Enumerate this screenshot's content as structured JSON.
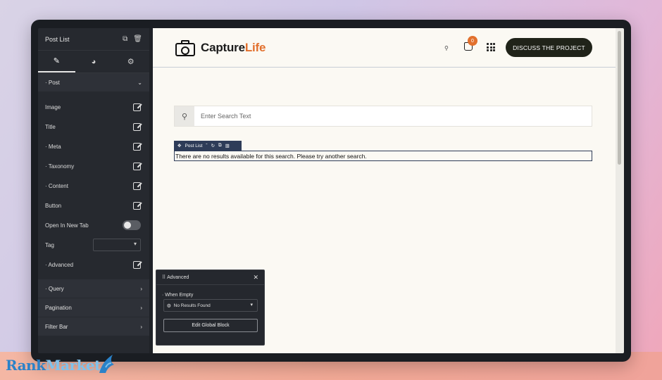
{
  "sidebar": {
    "title": "Post List",
    "section_post": "Post",
    "rows": [
      {
        "label": "Image"
      },
      {
        "label": "Title"
      },
      {
        "label": "Meta"
      },
      {
        "label": "Taxonomy"
      },
      {
        "label": "Content"
      },
      {
        "label": "Button"
      }
    ],
    "open_new_tab": "Open In New Tab",
    "tag_label": "Tag",
    "advanced": "Advanced",
    "collapsed": [
      "Query",
      "Pagination",
      "Filter Bar"
    ]
  },
  "header": {
    "logo_main": "Capture",
    "logo_accent": "Life",
    "cart_count": "0",
    "cta": "DISCUSS THE PROJECT"
  },
  "search": {
    "placeholder": "Enter Search Text"
  },
  "post_list": {
    "toolbar_label": "Post List",
    "empty_message": "There are no results available for this search. Please try another search."
  },
  "advanced_panel": {
    "title": "Advanced",
    "when_empty_label": "When Empty",
    "selected": "No Results Found",
    "button": "Edit Global Block"
  },
  "brand": {
    "part1": "Rank",
    "part2": "Market"
  },
  "colors": {
    "accent": "#e2702d",
    "cta_bg": "#202319",
    "sidebar_bg": "#26292f",
    "canvas_bg": "#fbf9f3"
  }
}
